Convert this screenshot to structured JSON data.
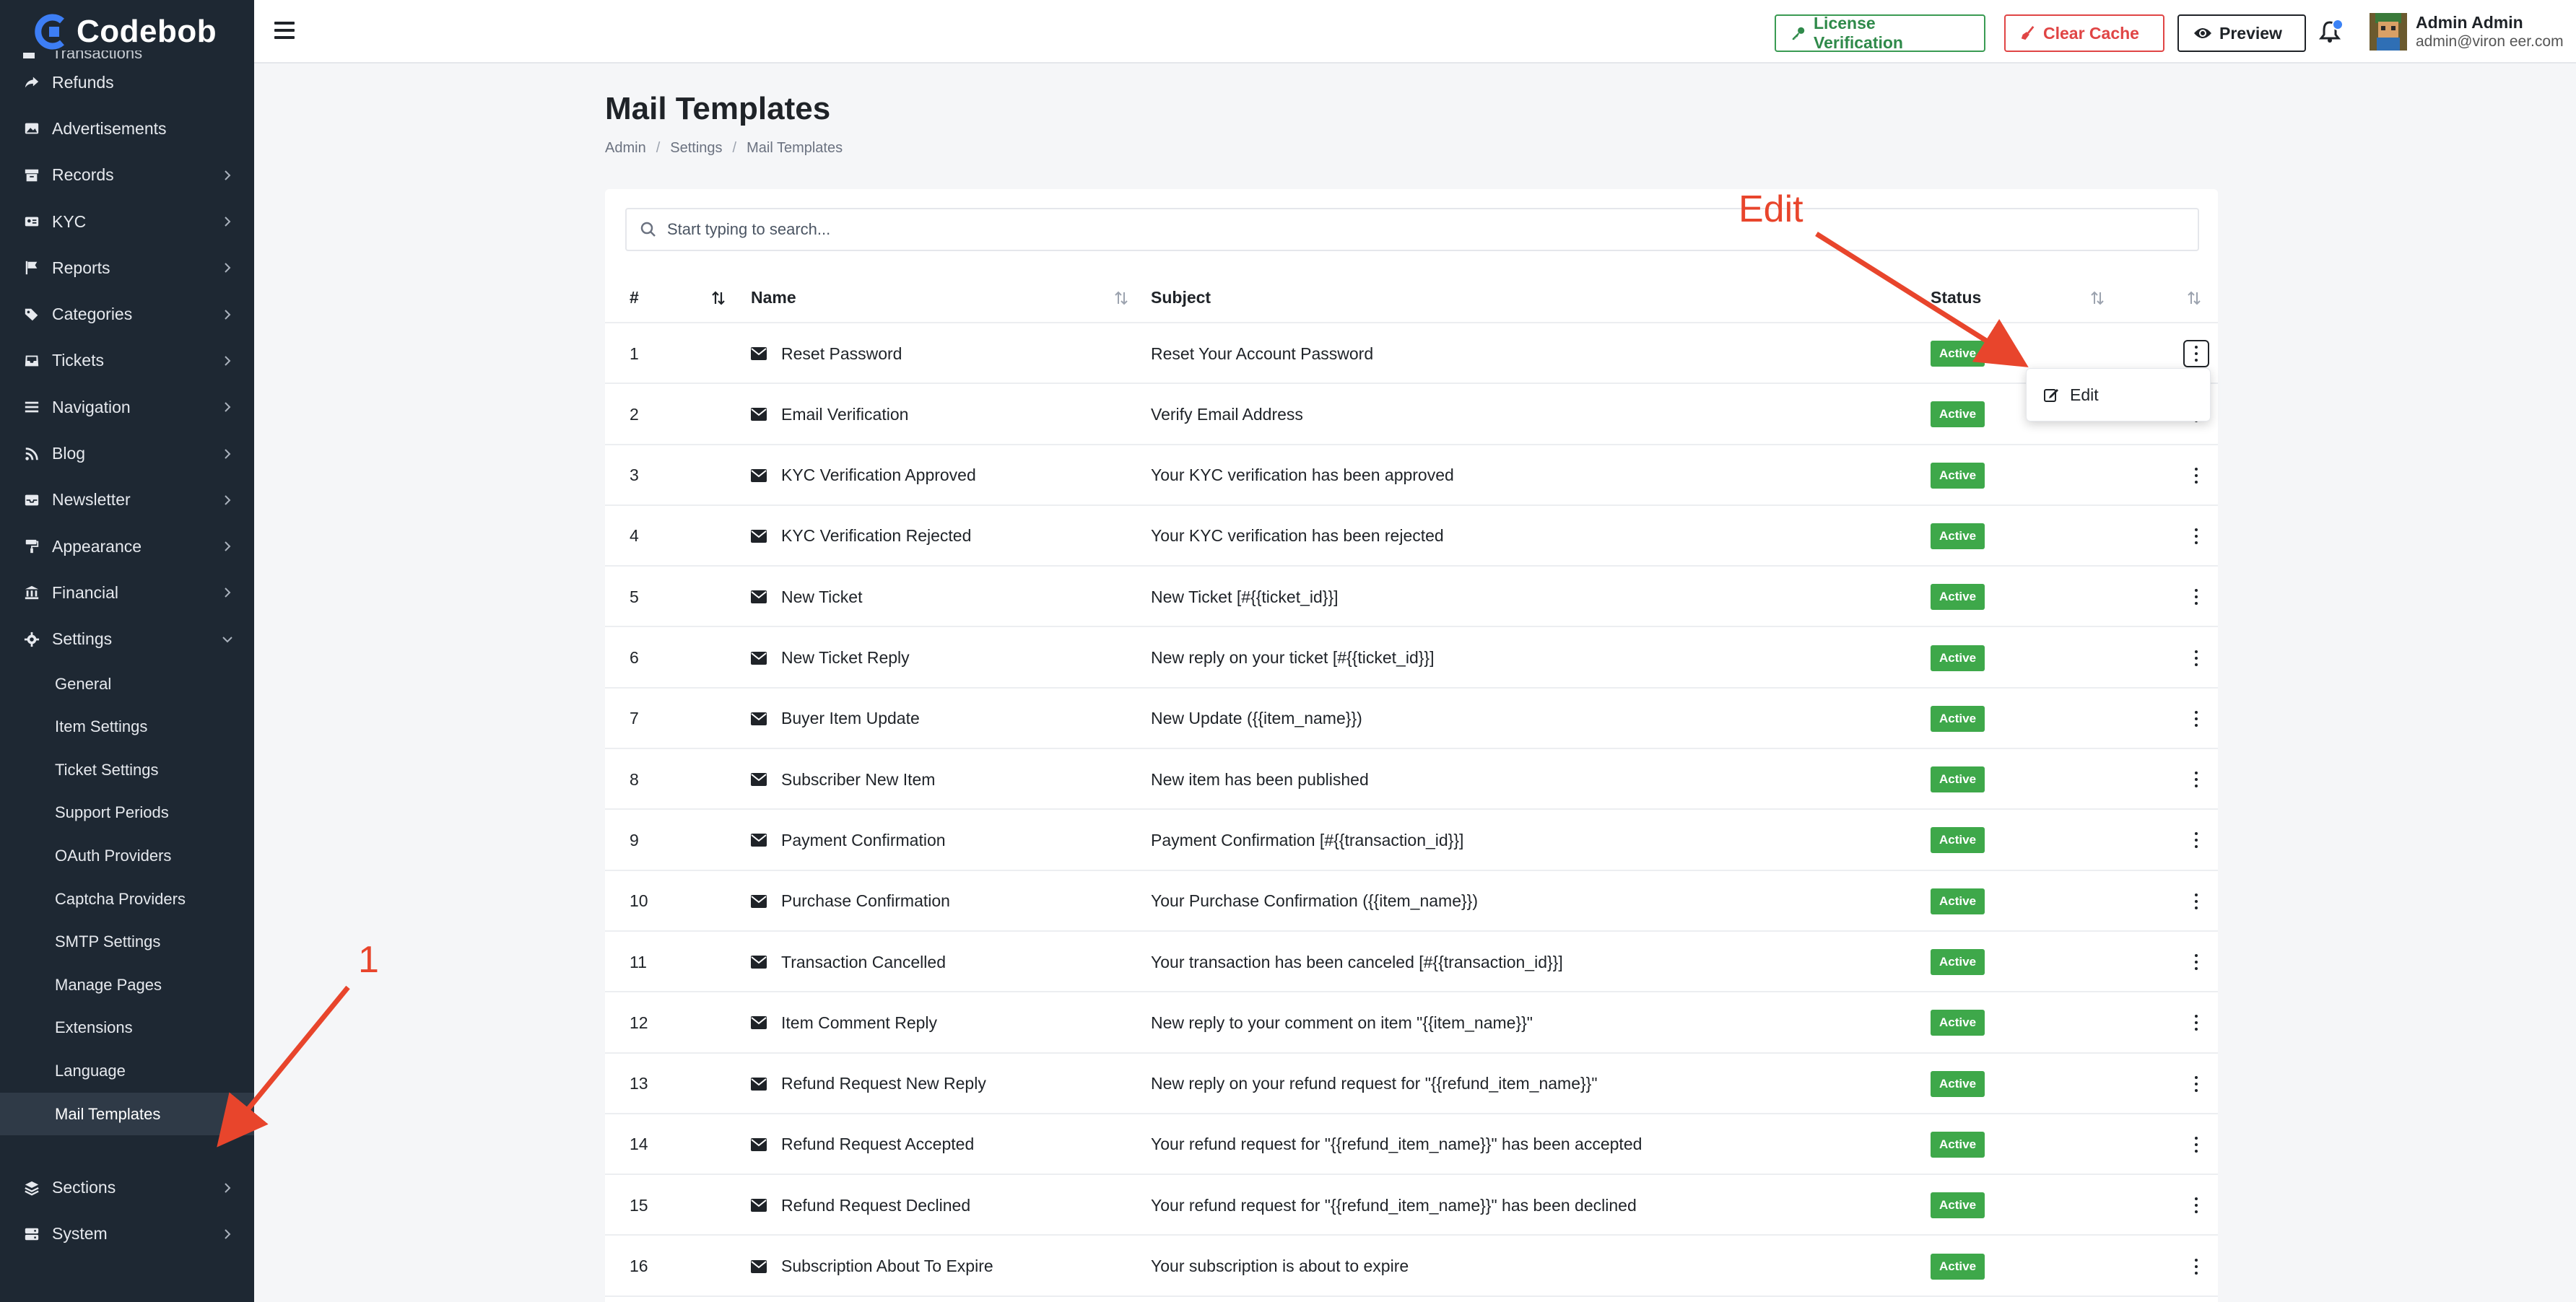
{
  "brand": {
    "name": "Codebob"
  },
  "sidebar": {
    "partial_top": "Transactions",
    "items": [
      {
        "label": "Refunds",
        "icon": "share-icon",
        "chevron": false
      },
      {
        "label": "Advertisements",
        "icon": "image-icon",
        "chevron": false
      },
      {
        "label": "Records",
        "icon": "archive-icon",
        "chevron": true
      },
      {
        "label": "KYC",
        "icon": "id-card-icon",
        "chevron": true
      },
      {
        "label": "Reports",
        "icon": "flag-icon",
        "chevron": true
      },
      {
        "label": "Categories",
        "icon": "tags-icon",
        "chevron": true
      },
      {
        "label": "Tickets",
        "icon": "inbox-icon",
        "chevron": true
      },
      {
        "label": "Navigation",
        "icon": "bars-icon",
        "chevron": true
      },
      {
        "label": "Blog",
        "icon": "rss-icon",
        "chevron": true
      },
      {
        "label": "Newsletter",
        "icon": "mail-inbox-icon",
        "chevron": true
      },
      {
        "label": "Appearance",
        "icon": "paint-roller-icon",
        "chevron": true
      },
      {
        "label": "Financial",
        "icon": "bank-icon",
        "chevron": true
      },
      {
        "label": "Settings",
        "icon": "gear-icon",
        "chevron": true,
        "expanded": true
      }
    ],
    "settings_sub": [
      {
        "label": "General"
      },
      {
        "label": "Item Settings"
      },
      {
        "label": "Ticket Settings"
      },
      {
        "label": "Support Periods"
      },
      {
        "label": "OAuth Providers"
      },
      {
        "label": "Captcha Providers"
      },
      {
        "label": "SMTP Settings"
      },
      {
        "label": "Manage Pages"
      },
      {
        "label": "Extensions"
      },
      {
        "label": "Language"
      },
      {
        "label": "Mail Templates",
        "active": true
      }
    ],
    "bottom": [
      {
        "label": "Sections",
        "icon": "layers-icon"
      },
      {
        "label": "System",
        "icon": "server-icon"
      }
    ]
  },
  "topbar": {
    "license_label": "License Verification",
    "clear_cache_label": "Clear Cache",
    "preview_label": "Preview",
    "user_name": "Admin Admin",
    "user_email": "admin@viron eer.com"
  },
  "page": {
    "title": "Mail Templates",
    "breadcrumb": [
      "Admin",
      "Settings",
      "Mail Templates"
    ]
  },
  "search": {
    "placeholder": "Start typing to search..."
  },
  "table": {
    "headers": {
      "id": "#",
      "name": "Name",
      "subject": "Subject",
      "status": "Status"
    },
    "rows": [
      {
        "id": "1",
        "name": "Reset Password",
        "subject": "Reset Your Account Password",
        "status": "Active"
      },
      {
        "id": "2",
        "name": "Email Verification",
        "subject": "Verify Email Address",
        "status": "Active"
      },
      {
        "id": "3",
        "name": "KYC Verification Approved",
        "subject": "Your KYC verification has been approved",
        "status": "Active"
      },
      {
        "id": "4",
        "name": "KYC Verification Rejected",
        "subject": "Your KYC verification has been rejected",
        "status": "Active"
      },
      {
        "id": "5",
        "name": "New Ticket",
        "subject": "New Ticket [#{{ticket_id}}]",
        "status": "Active"
      },
      {
        "id": "6",
        "name": "New Ticket Reply",
        "subject": "New reply on your ticket [#{{ticket_id}}]",
        "status": "Active"
      },
      {
        "id": "7",
        "name": "Buyer Item Update",
        "subject": "New Update ({{item_name}})",
        "status": "Active"
      },
      {
        "id": "8",
        "name": "Subscriber New Item",
        "subject": "New item has been published",
        "status": "Active"
      },
      {
        "id": "9",
        "name": "Payment Confirmation",
        "subject": "Payment Confirmation [#{{transaction_id}}]",
        "status": "Active"
      },
      {
        "id": "10",
        "name": "Purchase Confirmation",
        "subject": "Your Purchase Confirmation ({{item_name}})",
        "status": "Active"
      },
      {
        "id": "11",
        "name": "Transaction Cancelled",
        "subject": "Your transaction has been canceled [#{{transaction_id}}]",
        "status": "Active"
      },
      {
        "id": "12",
        "name": "Item Comment Reply",
        "subject": "New reply to your comment on item \"{{item_name}}\"",
        "status": "Active"
      },
      {
        "id": "13",
        "name": "Refund Request New Reply",
        "subject": "New reply on your refund request for \"{{refund_item_name}}\"",
        "status": "Active"
      },
      {
        "id": "14",
        "name": "Refund Request Accepted",
        "subject": "Your refund request for \"{{refund_item_name}}\" has been accepted",
        "status": "Active"
      },
      {
        "id": "15",
        "name": "Refund Request Declined",
        "subject": "Your refund request for \"{{refund_item_name}}\" has been declined",
        "status": "Active"
      },
      {
        "id": "16",
        "name": "Subscription About To Expire",
        "subject": "Your subscription is about to expire",
        "status": "Active"
      }
    ]
  },
  "dropdown": {
    "edit_label": "Edit"
  },
  "annotations": {
    "edit": "Edit",
    "one": "1"
  },
  "colors": {
    "sidebar_bg": "#1e2833",
    "active_badge": "#3ea84a",
    "license": "#2f8a4a",
    "cache": "#e04545",
    "annotation": "#e8452c"
  }
}
